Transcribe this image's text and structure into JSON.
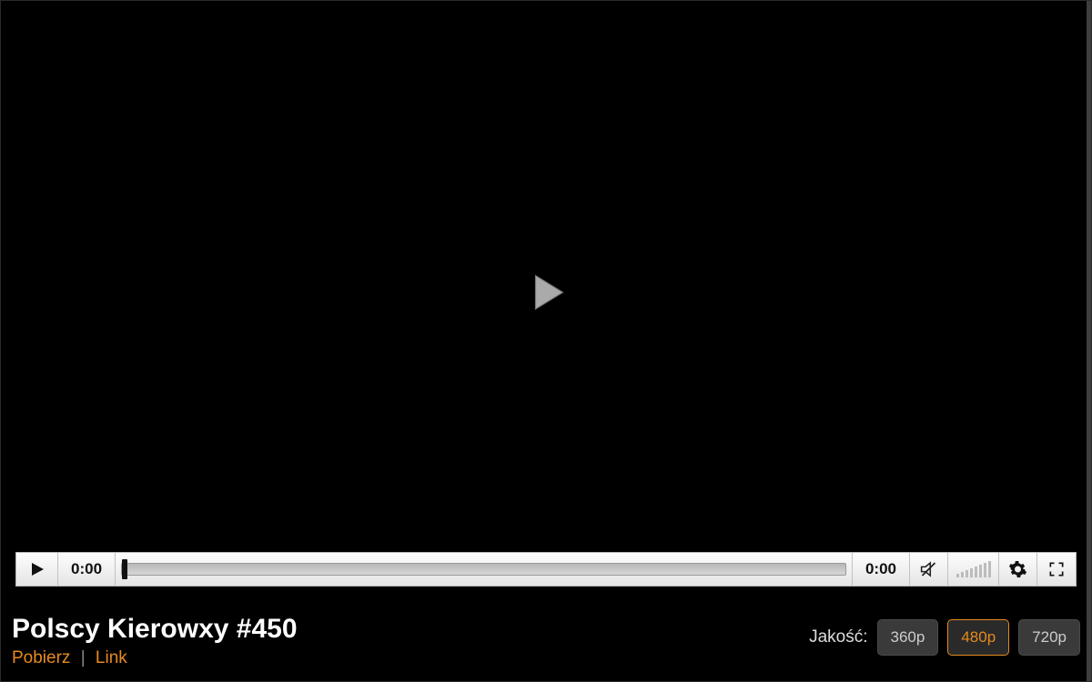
{
  "player": {
    "current_time": "0:00",
    "duration": "0:00"
  },
  "video": {
    "title": "Polscy Kierowxy #450",
    "download_label": "Pobierz",
    "link_label": "Link",
    "separator": "|"
  },
  "quality": {
    "label": "Jakość:",
    "options": [
      "360p",
      "480p",
      "720p"
    ],
    "active": "480p"
  }
}
